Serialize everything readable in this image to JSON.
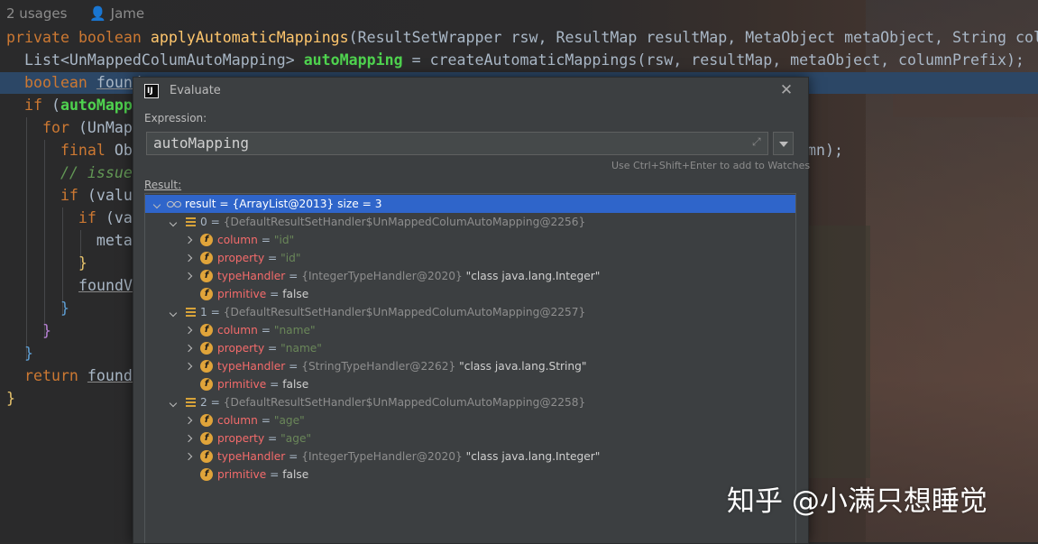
{
  "editor": {
    "usages": "2 usages",
    "author": "Jame",
    "lines": {
      "l1_private": "private ",
      "l1_boolean": "boolean ",
      "l1_method": "applyAutomaticMappings",
      "l1_params": "(ResultSetWrapper rsw, ResultMap resultMap, MetaObject metaObject, String col",
      "l2_list": "  List<UnMappedColumAutoMapping> ",
      "l2_var": "autoMapping",
      "l2_rest": " = createAutomaticMappings(rsw, resultMap, metaObject, columnPrefix);",
      "l3_boolean": "  boolean ",
      "l3_var": "found",
      "l4_if": "  if ",
      "l4_paren": "(",
      "l4_var": "autoMapp",
      "l5_for": "    for ",
      "l5_rest": "(UnMap",
      "l6_final": "      final ",
      "l6_rest": "Ob",
      "l6_tail": "mn);",
      "l7_comment": "      // issue",
      "l8_if": "      if ",
      "l8_rest": "(valu",
      "l9_if": "        if ",
      "l9_rest": "(va",
      "l10_meta": "          meta",
      "l11_brace": "        }",
      "l12_found": "foundV",
      "l13_brace": "      }",
      "l14_brace": "    }",
      "l15_brace": "  }",
      "l16_return": "  return ",
      "l16_var": "found",
      "l17_brace": "}"
    }
  },
  "dialog": {
    "title": "Evaluate",
    "icon_label": "IJ",
    "close_glyph": "✕",
    "expression_label": "Expression:",
    "expression_value": "autoMapping",
    "expand_glyph": "⤢",
    "hint": "Use Ctrl+Shift+Enter to add to Watches",
    "result_label": "Result:",
    "tree": {
      "root": {
        "name": "result",
        "eq": " = ",
        "ref": "{ArrayList@2013}",
        "size": "  size = 3"
      },
      "items": [
        {
          "index": "0",
          "eq": " = ",
          "ref": "{DefaultResultSetHandler$UnMappedColumAutoMapping@2256}",
          "fields": [
            {
              "name": "column",
              "eq": " = ",
              "value": "\"id\"",
              "kind": "str"
            },
            {
              "name": "property",
              "eq": " = ",
              "value": "\"id\"",
              "kind": "str"
            },
            {
              "name": "typeHandler",
              "eq": " = ",
              "ref": "{IntegerTypeHandler@2020}",
              "value": " \"class java.lang.Integer\"",
              "kind": "obj"
            },
            {
              "name": "primitive",
              "eq": " = ",
              "value": "false",
              "kind": "plain"
            }
          ]
        },
        {
          "index": "1",
          "eq": " = ",
          "ref": "{DefaultResultSetHandler$UnMappedColumAutoMapping@2257}",
          "fields": [
            {
              "name": "column",
              "eq": " = ",
              "value": "\"name\"",
              "kind": "str"
            },
            {
              "name": "property",
              "eq": " = ",
              "value": "\"name\"",
              "kind": "str"
            },
            {
              "name": "typeHandler",
              "eq": " = ",
              "ref": "{StringTypeHandler@2262}",
              "value": " \"class java.lang.String\"",
              "kind": "obj"
            },
            {
              "name": "primitive",
              "eq": " = ",
              "value": "false",
              "kind": "plain"
            }
          ]
        },
        {
          "index": "2",
          "eq": " = ",
          "ref": "{DefaultResultSetHandler$UnMappedColumAutoMapping@2258}",
          "fields": [
            {
              "name": "column",
              "eq": " = ",
              "value": "\"age\"",
              "kind": "str"
            },
            {
              "name": "property",
              "eq": " = ",
              "value": "\"age\"",
              "kind": "str"
            },
            {
              "name": "typeHandler",
              "eq": " = ",
              "ref": "{IntegerTypeHandler@2020}",
              "value": " \"class java.lang.Integer\"",
              "kind": "obj"
            },
            {
              "name": "primitive",
              "eq": " = ",
              "value": "false",
              "kind": "plain"
            }
          ]
        }
      ]
    }
  },
  "watermark": "知乎 @小满只想睡觉",
  "colors": {
    "selection": "#2f65ca",
    "field_name": "#f46b6b",
    "string_value": "#6a8759",
    "keyword": "#cc7832",
    "method": "#ffc66d",
    "highlight_var": "#4fd34f"
  }
}
